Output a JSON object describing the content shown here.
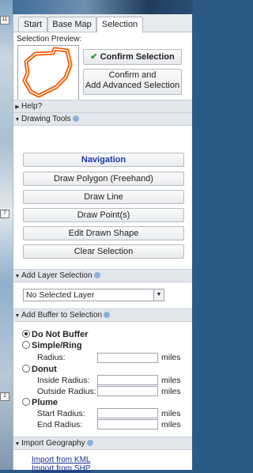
{
  "map": {
    "tags": [
      "11",
      "7",
      "2"
    ]
  },
  "tabs": [
    {
      "label": "Start"
    },
    {
      "label": "Base Map"
    },
    {
      "label": "Selection"
    }
  ],
  "selection": {
    "preview_label": "Selection Preview:",
    "confirm_label": "Confirm Selection",
    "confirm_advanced_line1": "Confirm and",
    "confirm_advanced_line2": "Add Advanced Selection"
  },
  "sections": {
    "help": "Help?",
    "drawing_tools": "Drawing Tools",
    "add_layer": "Add Layer Selection",
    "add_buffer": "Add Buffer to Selection",
    "import_geo": "Import Geography"
  },
  "tools": [
    "Navigation",
    "Draw Polygon (Freehand)",
    "Draw Line",
    "Draw Point(s)",
    "Edit Drawn Shape",
    "Clear Selection"
  ],
  "layer": {
    "selected": "No Selected Layer"
  },
  "buffer": {
    "options": [
      "Do Not Buffer",
      "Simple/Ring",
      "Donut",
      "Plume"
    ],
    "selected": "Do Not Buffer",
    "fields": {
      "radius": {
        "label": "Radius:",
        "value": "",
        "unit": "miles"
      },
      "inside_radius": {
        "label": "Inside Radius:",
        "value": "",
        "unit": "miles"
      },
      "outside_radius": {
        "label": "Outside Radius:",
        "value": "",
        "unit": "miles"
      },
      "start_radius": {
        "label": "Start Radius:",
        "value": "",
        "unit": "miles"
      },
      "end_radius": {
        "label": "End Radius:",
        "value": "",
        "unit": "miles"
      }
    }
  },
  "import": {
    "links": [
      "Import from KML",
      "Import from SHP"
    ]
  },
  "colors": {
    "accent": "#f05a00",
    "check": "#2a9a2a",
    "link": "#1a2f8a"
  }
}
